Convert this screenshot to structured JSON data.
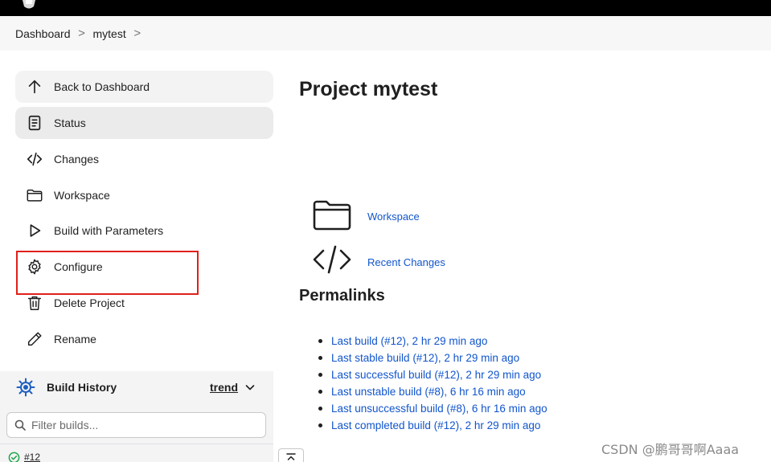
{
  "breadcrumb": {
    "items": [
      "Dashboard",
      "mytest"
    ],
    "separator": ">"
  },
  "sidebar": {
    "items": [
      {
        "label": "Back to Dashboard",
        "icon": "arrow-up-icon"
      },
      {
        "label": "Status",
        "icon": "document-icon"
      },
      {
        "label": "Changes",
        "icon": "code-icon"
      },
      {
        "label": "Workspace",
        "icon": "folder-icon"
      },
      {
        "label": "Build with Parameters",
        "icon": "play-icon"
      },
      {
        "label": "Configure",
        "icon": "gear-icon"
      },
      {
        "label": "Delete Project",
        "icon": "trash-icon"
      },
      {
        "label": "Rename",
        "icon": "pencil-icon"
      }
    ],
    "active_item": "Status"
  },
  "build_history": {
    "title": "Build History",
    "trend_label": "trend",
    "filter_placeholder": "Filter builds...",
    "builds": [
      {
        "number": "#12",
        "status": "success"
      }
    ]
  },
  "main": {
    "title": "Project mytest",
    "links": [
      {
        "label": "Workspace",
        "icon": "folder-icon"
      },
      {
        "label": "Recent Changes",
        "icon": "code-icon"
      }
    ],
    "permalinks_title": "Permalinks",
    "permalinks": [
      "Last build (#12), 2 hr 29 min ago",
      "Last stable build (#12), 2 hr 29 min ago",
      "Last successful build (#12), 2 hr 29 min ago",
      "Last unstable build (#8), 6 hr 16 min ago",
      "Last unsuccessful build (#8), 6 hr 16 min ago",
      "Last completed build (#12), 2 hr 29 min ago"
    ]
  },
  "watermark": "CSDN @鹏哥哥啊Aaaa",
  "colors": {
    "link": "#1155cc",
    "highlight_box": "#e0201b",
    "success": "#1ea64b"
  }
}
